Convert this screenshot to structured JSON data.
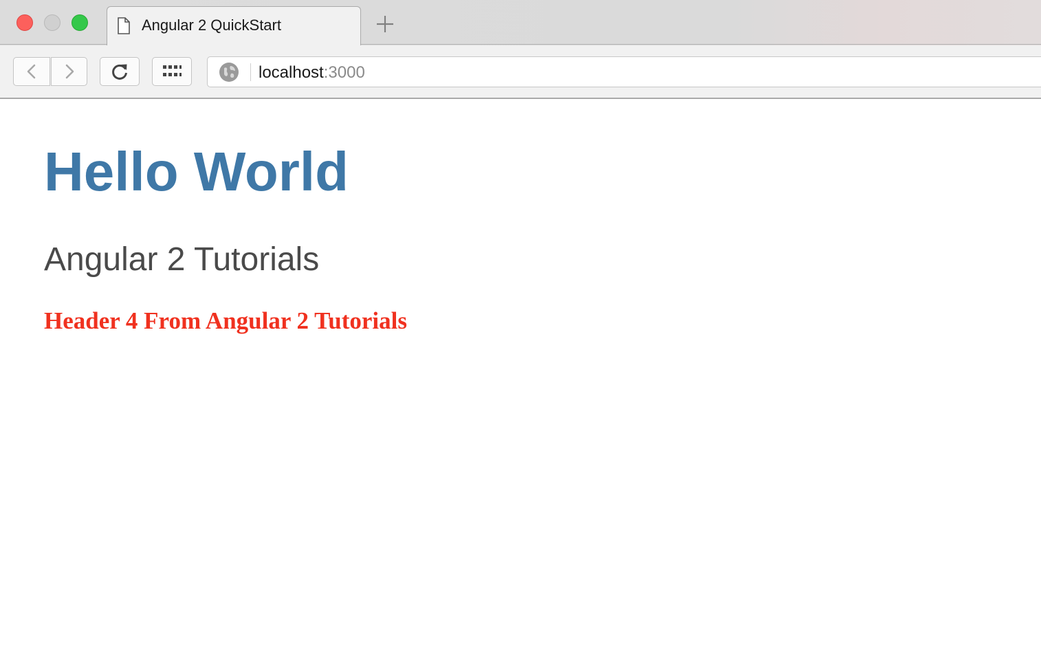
{
  "browser": {
    "tab": {
      "title": "Angular 2 QuickStart",
      "icon": "document-icon"
    },
    "address_bar": {
      "host": "localhost",
      "port": ":3000",
      "icon": "globe-icon"
    },
    "colors": {
      "close": "#fc605c",
      "minimize": "#d0d0d0",
      "maximize": "#34c84a"
    }
  },
  "page": {
    "heading1": "Hello World",
    "heading2": "Angular 2 Tutorials",
    "heading4": "Header 4 From Angular 2 Tutorials",
    "colors": {
      "heading1": "#3f78a7",
      "heading2": "#4a4a4a",
      "heading4": "#f0311f"
    }
  }
}
